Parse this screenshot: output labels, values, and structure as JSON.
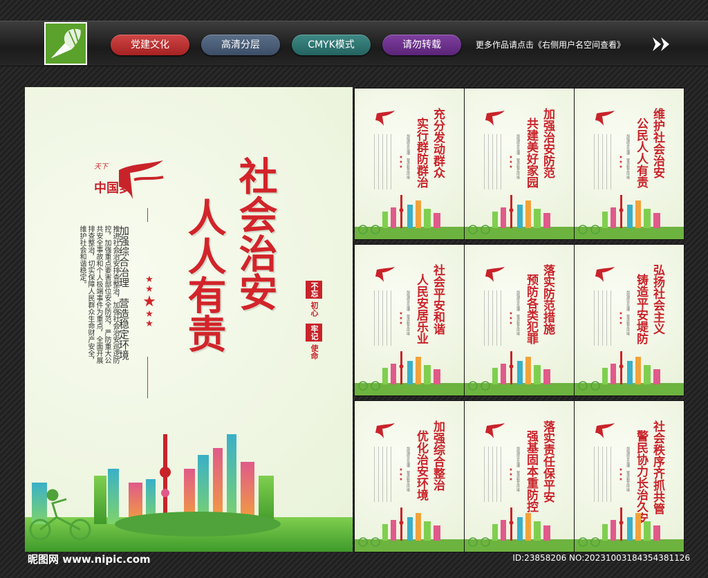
{
  "toolbar": {
    "pills": [
      "党建文化",
      "高清分层",
      "CMYK模式",
      "请勿转载"
    ],
    "more_text": "更多作品请点击《右侧用户名空间查看》",
    "arrows_icon": "double-chevron-right-icon",
    "logo_icon": "hot-air-balloon-icon"
  },
  "main_poster": {
    "logo_text": "中国梦",
    "title_line1": "社会治安",
    "title_line2": "人人有责",
    "subtitle": "加强综合治理　营造稳定环境",
    "body": "推进社会治安排查整治，加强社会治安巡逻防控，加强重点要害部位安全防范，严防重大公共安全事故和个人极端事件为重点，全面开展排查整治，切实保障人民群众生命财产安全，维护社会和谐稳定。",
    "seal_1": "不忘",
    "seal_1b": "初心",
    "seal_2": "牢记",
    "seal_2b": "使命"
  },
  "small_posters": [
    {
      "line1": "充分发动群众",
      "line2": "实行群防群治"
    },
    {
      "line1": "加强治安防范",
      "line2": "共建美好家园"
    },
    {
      "line1": "维护社会治安",
      "line2": "公民人人有责"
    },
    {
      "line1": "社会平安和谐",
      "line2": "人民安居乐业"
    },
    {
      "line1": "落实防范措施",
      "line2": "预防各类犯罪"
    },
    {
      "line1": "弘扬社会主义",
      "line2": "铸造平安堤防"
    },
    {
      "line1": "加强综合整治",
      "line2": "优化治安环境"
    },
    {
      "line1": "落实责任保平安",
      "line2": "强基固本重防控"
    },
    {
      "line1": "社会秩序齐抓共管",
      "line2": "警民协力长治久安"
    }
  ],
  "small_tiny": "加强综合治理　营造稳定环境",
  "footer": {
    "site": "昵图网 www.nipic.com",
    "id": "ID:23858206 NO:20231003184354381126"
  },
  "colors": {
    "title_red": "#d2242a",
    "grass": "#6db33f",
    "sky": "#eef5e0"
  }
}
